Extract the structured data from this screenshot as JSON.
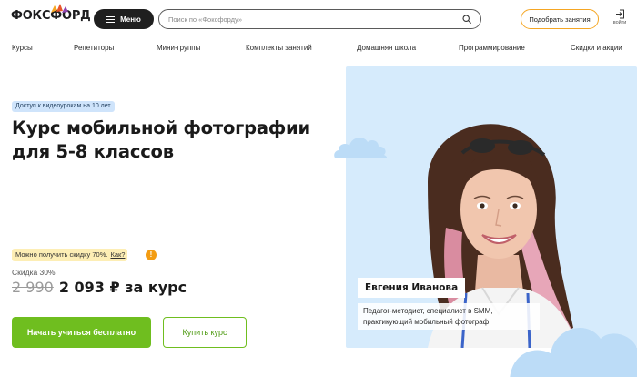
{
  "header": {
    "logo_text": "ФОКСФОРД",
    "menu_label": "Меню",
    "search_placeholder": "Поиск по «Фоксфорду»",
    "pick_button": "Подобрать занятия",
    "login_label": "войти"
  },
  "nav": {
    "items": [
      "Курсы",
      "Репетиторы",
      "Мини-группы",
      "Комплекты занятий",
      "Домашняя школа",
      "Программирование",
      "Скидки и акции"
    ]
  },
  "hero": {
    "access_badge": "Доступ к видеоурокам на 10 лет",
    "title_line1": "Курс мобильной фотографии",
    "title_line2": "для 5-8 классов",
    "discount_note": "Можно получить скидку 70%.",
    "discount_how": "Как?",
    "warn_symbol": "!",
    "sale_label": "Скидка 30%",
    "old_price": "2 990",
    "new_price": "2 093 ₽ за курс",
    "start_button": "Начать учиться бесплатно",
    "buy_button": "Купить курс"
  },
  "teacher": {
    "name": "Евгения Иванова",
    "description": "Педагог-методист, специалист в SMM, практикующий мобильный фотограф"
  },
  "colors": {
    "accent_green": "#6fbe1f",
    "accent_orange": "#f5a623",
    "hero_blue": "#d6ebfc",
    "badge_blue": "#cfe4fb",
    "badge_yellow": "#fdeeb5"
  }
}
